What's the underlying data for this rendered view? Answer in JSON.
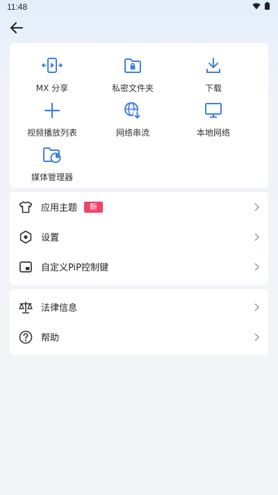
{
  "status": {
    "time": "11:48"
  },
  "shortcuts": [
    {
      "label": "MX 分享",
      "icon": "mx-share-icon"
    },
    {
      "label": "私密文件夹",
      "icon": "private-folder-icon"
    },
    {
      "label": "下载",
      "icon": "download-icon"
    },
    {
      "label": "视频播放列表",
      "icon": "plus-icon"
    },
    {
      "label": "网络串流",
      "icon": "globe-download-icon"
    },
    {
      "label": "本地网络",
      "icon": "monitor-icon"
    },
    {
      "label": "媒体管理器",
      "icon": "folder-pie-icon"
    }
  ],
  "settings_list": [
    {
      "label": "应用主题",
      "icon": "tshirt-icon",
      "badge": "新"
    },
    {
      "label": "设置",
      "icon": "hexagon-gear-icon"
    },
    {
      "label": "自定义PiP控制键",
      "icon": "pip-icon"
    }
  ],
  "info_list": [
    {
      "label": "法律信息",
      "icon": "scales-icon"
    },
    {
      "label": "帮助",
      "icon": "help-circle-icon"
    }
  ],
  "colors": {
    "accent": "#3d7fe0",
    "badge": "#f0436a",
    "chevron": "#9a9a9a"
  }
}
